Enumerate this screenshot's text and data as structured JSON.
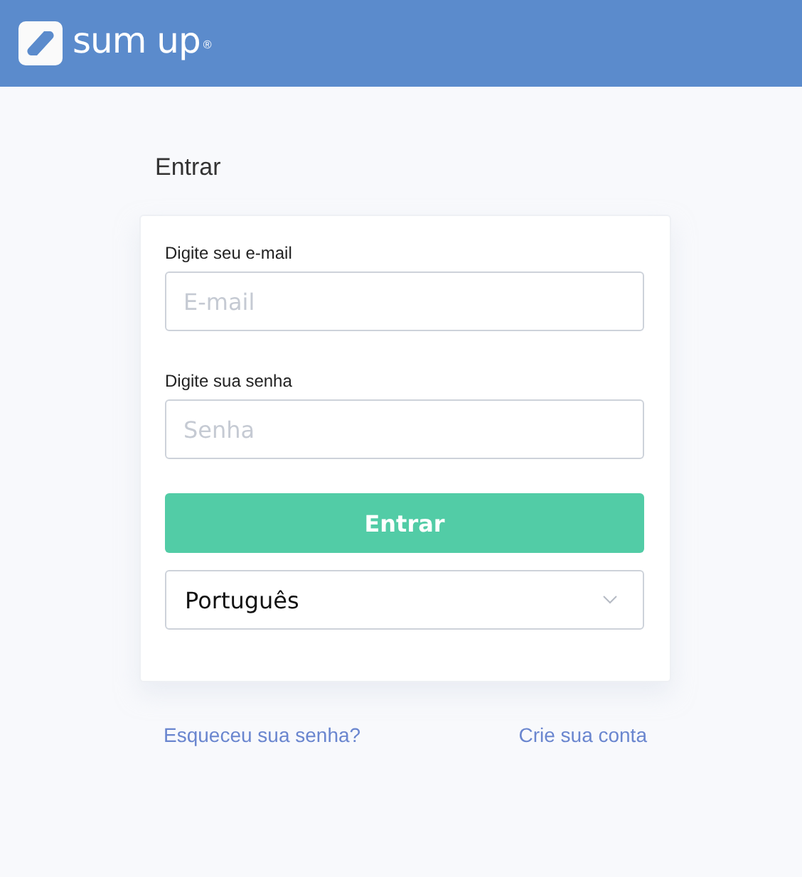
{
  "header": {
    "logo": {
      "wordmark": "sum up",
      "mark": "®"
    }
  },
  "title": "Entrar",
  "form": {
    "fields": [
      {
        "label": "Digite seu e-mail",
        "placeholder": "E-mail"
      },
      {
        "label": "Digite sua senha",
        "placeholder": "Senha"
      }
    ],
    "submit": "Entrar",
    "language": {
      "value": "Português"
    }
  },
  "links": [
    "Esqueceu sua senha?",
    "Crie sua conta"
  ]
}
